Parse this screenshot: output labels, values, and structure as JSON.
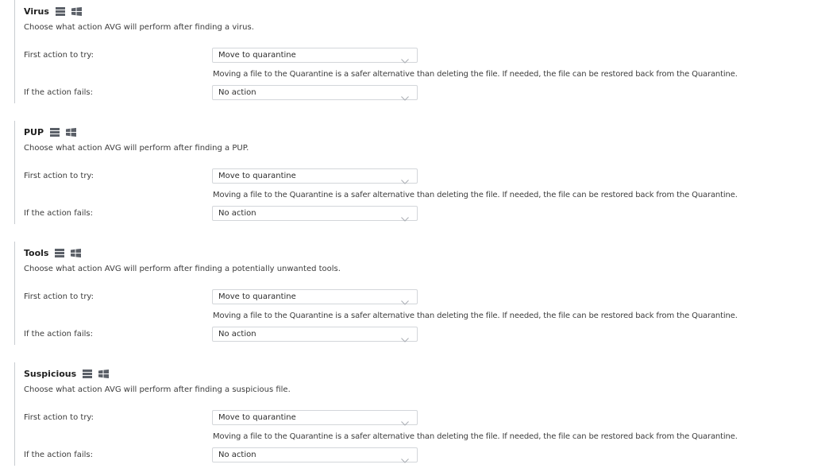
{
  "sections": [
    {
      "title": "Virus",
      "description": "Choose what action AVG will perform after finding a virus.",
      "first_action_label": "First action to try:",
      "first_action_value": "Move to quarantine",
      "hint": "Moving a file to the Quarantine is a safer alternative than deleting the file. If needed, the file can be restored back from the Quarantine.",
      "fail_label": "If the action fails:",
      "fail_value": "No action"
    },
    {
      "title": "PUP",
      "description": "Choose what action AVG will perform after finding a PUP.",
      "first_action_label": "First action to try:",
      "first_action_value": "Move to quarantine",
      "hint": "Moving a file to the Quarantine is a safer alternative than deleting the file. If needed, the file can be restored back from the Quarantine.",
      "fail_label": "If the action fails:",
      "fail_value": "No action"
    },
    {
      "title": "Tools",
      "description": "Choose what action AVG will perform after finding a potentially unwanted tools.",
      "first_action_label": "First action to try:",
      "first_action_value": "Move to quarantine",
      "hint": "Moving a file to the Quarantine is a safer alternative than deleting the file. If needed, the file can be restored back from the Quarantine.",
      "fail_label": "If the action fails:",
      "fail_value": "No action"
    },
    {
      "title": "Suspicious",
      "description": "Choose what action AVG will perform after finding a suspicious file.",
      "first_action_label": "First action to try:",
      "first_action_value": "Move to quarantine",
      "hint": "Moving a file to the Quarantine is a safer alternative than deleting the file. If needed, the file can be restored back from the Quarantine.",
      "fail_label": "If the action fails:",
      "fail_value": "No action"
    }
  ],
  "icons": {
    "server": "server-icon",
    "windows": "windows-icon",
    "chevron": "chevron-down-icon"
  },
  "colors": {
    "icon": "#5b6068",
    "border": "#d3d6da",
    "chevron": "#a9adb3"
  }
}
